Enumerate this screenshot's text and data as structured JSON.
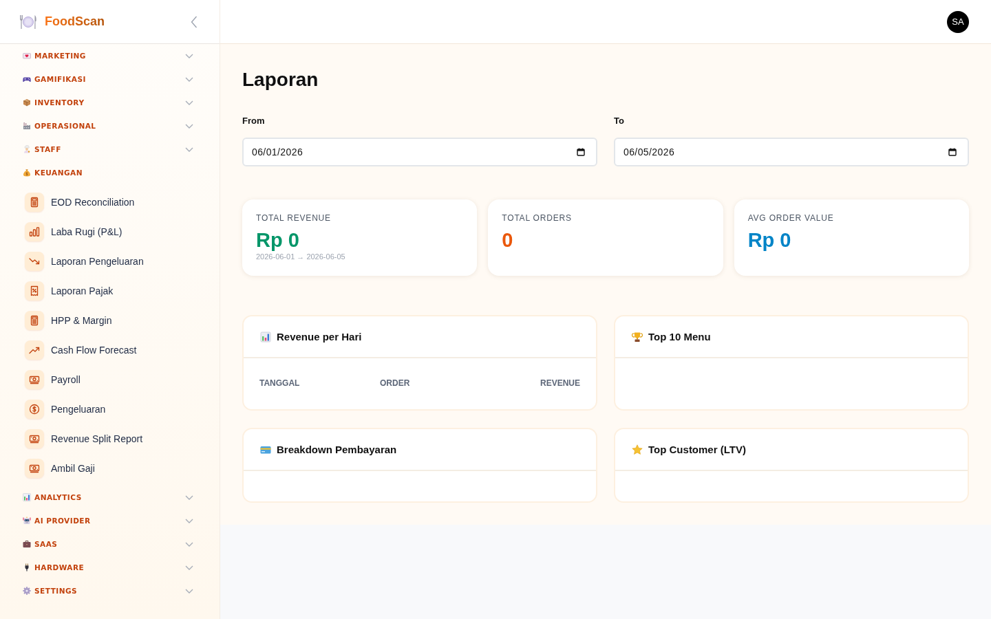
{
  "sidebar": {
    "brand": "FoodScan",
    "groups": [
      {
        "label": "MARKETING",
        "expanded": false
      },
      {
        "label": "GAMIFIKASI",
        "expanded": false
      },
      {
        "label": "INVENTORY",
        "expanded": false
      },
      {
        "label": "OPERASIONAL",
        "expanded": false
      },
      {
        "label": "STAFF",
        "expanded": false
      },
      {
        "label": "KEUANGAN",
        "expanded": true,
        "children": [
          {
            "label": "EOD Reconciliation",
            "selected": false
          },
          {
            "label": "Laba Rugi (P&L)",
            "selected": false
          },
          {
            "label": "Laporan Pengeluaran",
            "selected": false
          },
          {
            "label": "Laporan Pajak",
            "selected": false
          },
          {
            "label": "HPP & Margin",
            "selected": false
          },
          {
            "label": "Cash Flow Forecast",
            "selected": false
          },
          {
            "label": "Payroll",
            "selected": false
          },
          {
            "label": "Pengeluaran",
            "selected": false
          },
          {
            "label": "Revenue Split Report",
            "selected": false
          },
          {
            "label": "Ambil Gaji",
            "selected": false
          }
        ]
      },
      {
        "label": "ANALYTICS",
        "expanded": false
      },
      {
        "label": "AI PROVIDER",
        "expanded": false
      },
      {
        "label": "SAAS",
        "expanded": false
      },
      {
        "label": "HARDWARE",
        "expanded": false
      },
      {
        "label": "SETTINGS",
        "expanded": false
      }
    ]
  },
  "header": {
    "avatar": "SA"
  },
  "page": {
    "title": "Laporan",
    "filters": [
      {
        "label": "From",
        "value": "06/01/2026"
      },
      {
        "label": "To",
        "value": "06/05/2026"
      }
    ],
    "stats": [
      {
        "label": "TOTAL REVENUE",
        "value": "Rp 0",
        "color": "#059669",
        "note": "2026-06-01 → 2026-06-05"
      },
      {
        "label": "TOTAL ORDERS",
        "value": "0",
        "color": "#ea580c"
      },
      {
        "label": "AVG ORDER VALUE",
        "value": "Rp 0",
        "color": "#0284c7"
      }
    ],
    "panels": [
      {
        "title": "Revenue per Hari",
        "columns": [
          "TANGGAL",
          "ORDER",
          "REVENUE"
        ]
      },
      {
        "title": "Top 10 Menu"
      },
      {
        "title": "Breakdown Pembayaran"
      },
      {
        "title": "Top Customer (LTV)"
      }
    ]
  }
}
